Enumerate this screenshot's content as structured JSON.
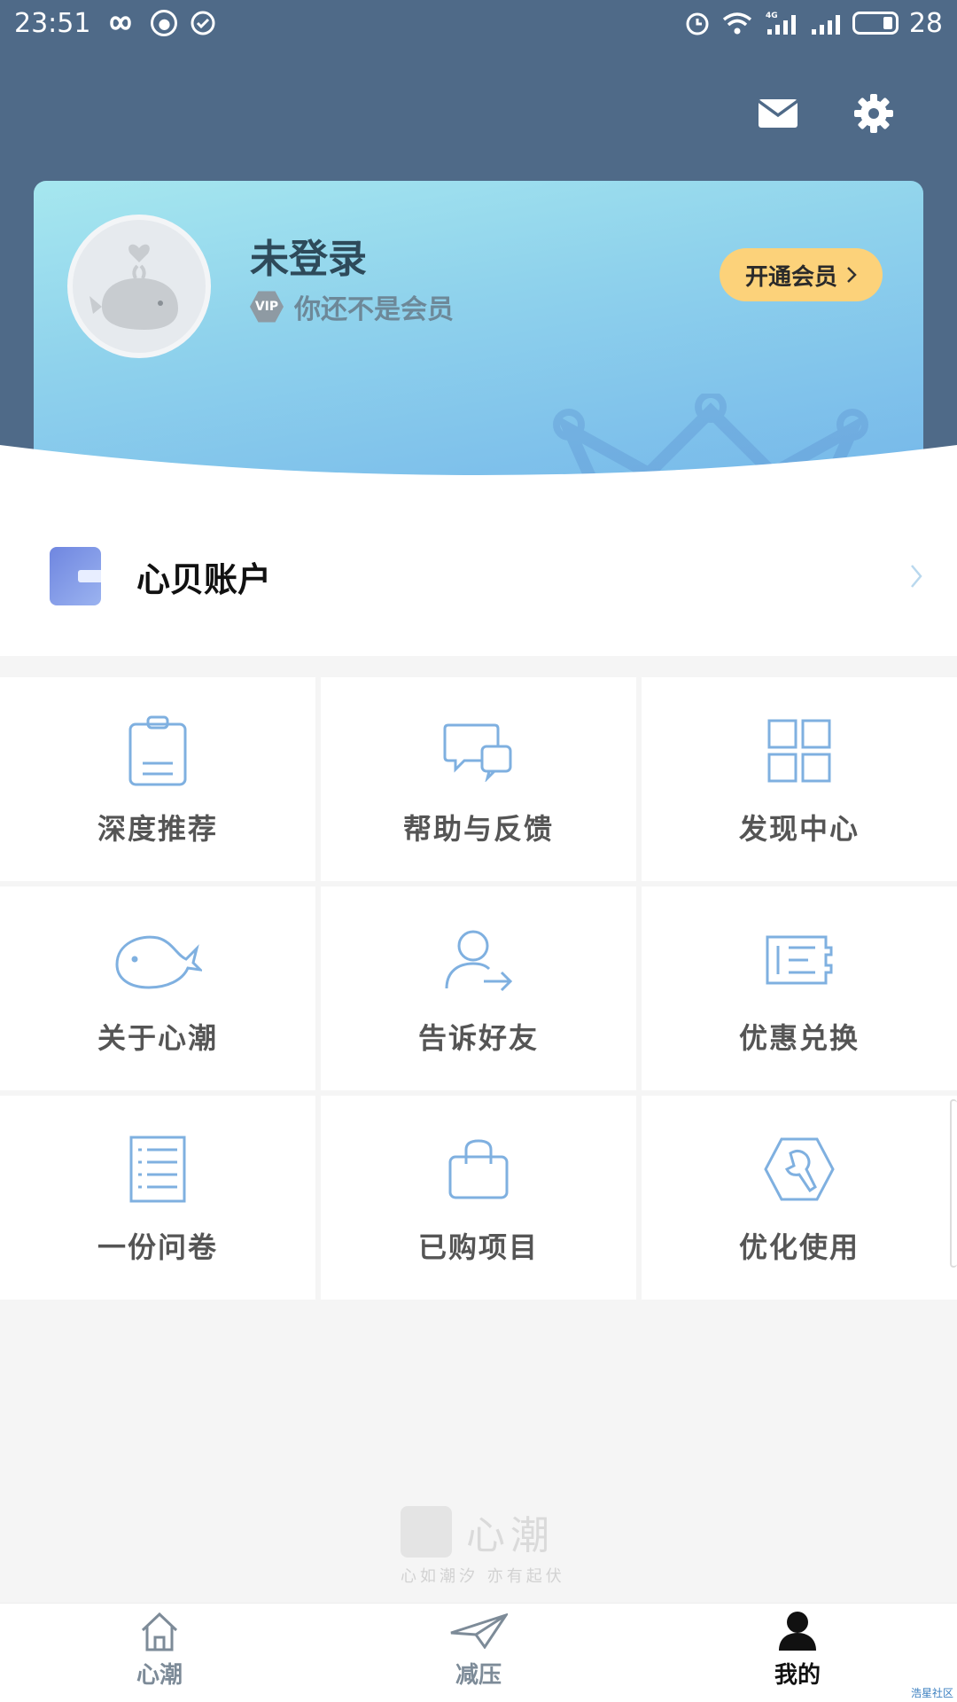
{
  "status_bar": {
    "time": "23:51",
    "network_label": "4G",
    "battery_level": "28"
  },
  "profile": {
    "name": "未登录",
    "vip_badge": "VIP",
    "vip_status": "你还不是会员",
    "member_button": "开通会员"
  },
  "wallet": {
    "label": "心贝账户"
  },
  "grid": {
    "items": [
      {
        "label": "深度推荐",
        "icon": "clipboard-icon"
      },
      {
        "label": "帮助与反馈",
        "icon": "chat-bubbles-icon"
      },
      {
        "label": "发现中心",
        "icon": "grid-icon"
      },
      {
        "label": "关于心潮",
        "icon": "whale-icon"
      },
      {
        "label": "告诉好友",
        "icon": "share-user-icon"
      },
      {
        "label": "优惠兑换",
        "icon": "ticket-icon"
      },
      {
        "label": "一份问卷",
        "icon": "document-list-icon"
      },
      {
        "label": "已购项目",
        "icon": "shopping-bag-icon"
      },
      {
        "label": "优化使用",
        "icon": "wrench-icon"
      }
    ]
  },
  "watermark": {
    "title": "心潮",
    "slogan": "心如潮汐 亦有起伏"
  },
  "nav": {
    "items": [
      {
        "label": "心潮",
        "icon": "home-icon"
      },
      {
        "label": "减压",
        "icon": "paper-plane-icon"
      },
      {
        "label": "我的",
        "icon": "person-icon"
      }
    ],
    "active": "我的"
  },
  "corner_tag": "浩星社区",
  "colors": {
    "header": "#4f6a88",
    "accent_icon": "#7fb0e0",
    "member_button": "#fcd27a"
  }
}
